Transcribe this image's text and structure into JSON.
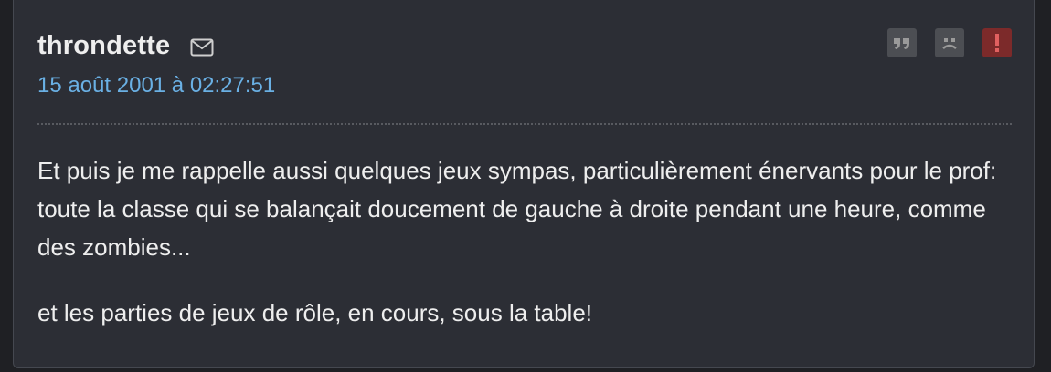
{
  "post": {
    "author": "throndette",
    "date": "15 août 2001 à 02:27:51",
    "paragraphs": [
      "Et puis je me rappelle aussi quelques jeux sympas, particulièrement énervants pour le prof: toute la classe qui se balançait doucement de gauche à droite pendant une heure, comme des zombies...",
      "et les parties de jeux de rôle, en cours, sous la table!"
    ]
  },
  "icons": {
    "mail": "mail-icon",
    "quote": "quote-icon",
    "sad": "sad-face-icon",
    "report": "exclamation-icon"
  },
  "colors": {
    "background": "#1f2024",
    "card": "#2c2e35",
    "date_link": "#6ab0e4",
    "report_button": "#7c2a2a",
    "action_button": "#4c4e53"
  }
}
